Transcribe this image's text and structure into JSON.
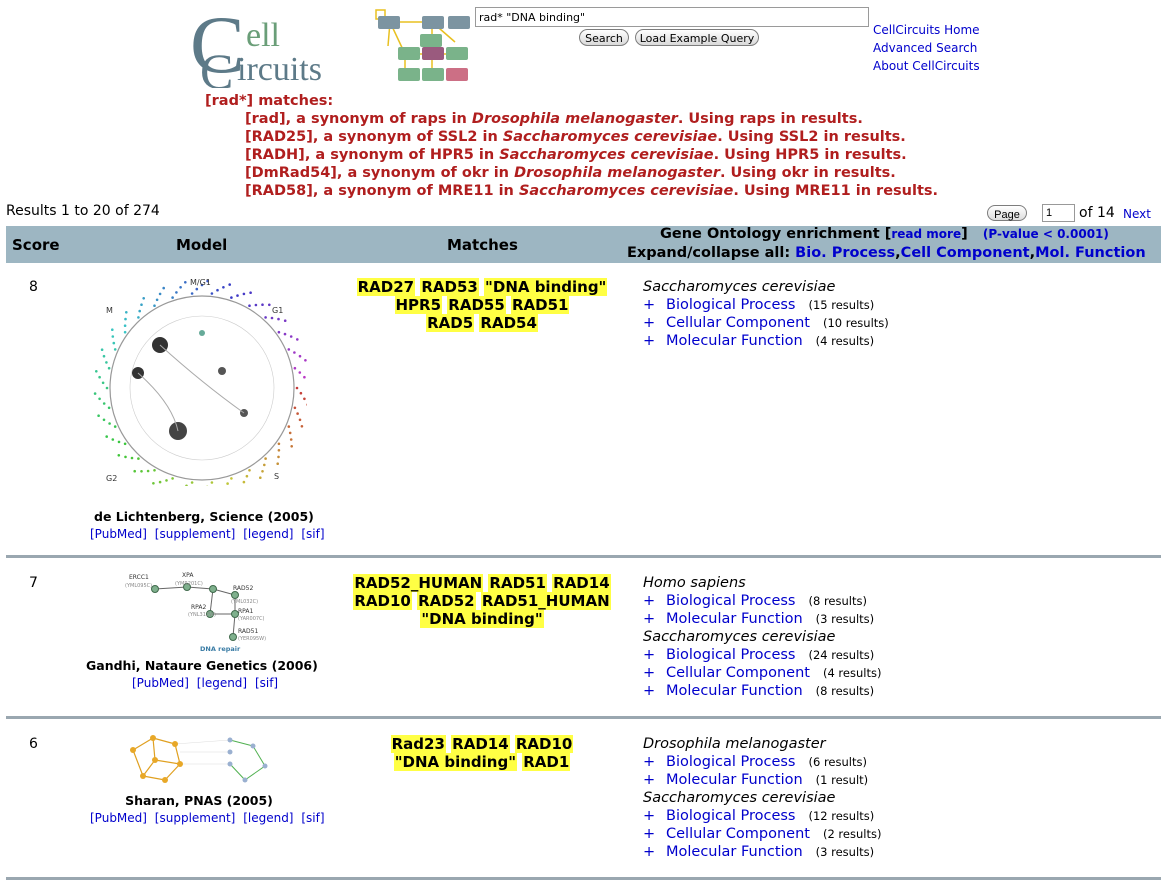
{
  "logo": {
    "word_top": "ell",
    "word_bottom": "ircuits",
    "letter_c": "C"
  },
  "search": {
    "value": "rad* \"DNA binding\"",
    "search_label": "Search",
    "example_label": "Load Example Query"
  },
  "nav": {
    "home": "CellCircuits Home",
    "advanced": "Advanced Search",
    "about": "About CellCircuits"
  },
  "synonyms": {
    "heading": "[rad*] matches:",
    "lines": [
      {
        "pre": "[rad], a synonym of raps in ",
        "species": "Drosophila melanogaster",
        "post": ". Using raps in results."
      },
      {
        "pre": "[RAD25], a synonym of SSL2 in ",
        "species": "Saccharomyces cerevisiae",
        "post": ". Using SSL2 in results."
      },
      {
        "pre": "[RADH], a synonym of HPR5 in ",
        "species": "Saccharomyces cerevisiae",
        "post": ". Using HPR5 in results."
      },
      {
        "pre": "[DmRad54], a synonym of okr in ",
        "species": "Drosophila melanogaster",
        "post": ". Using okr in results."
      },
      {
        "pre": "[RAD58], a synonym of MRE11 in ",
        "species": "Saccharomyces cerevisiae",
        "post": ". Using MRE11 in results."
      }
    ]
  },
  "results": {
    "summary": "Results 1 to 20 of 274",
    "page_button": "Page",
    "page_value": "1",
    "of_pages": "of 14",
    "next": "Next"
  },
  "table_header": {
    "score": "Score",
    "model": "Model",
    "matches": "Matches",
    "go_title": "Gene Ontology enrichment [",
    "read_more": "read more",
    "go_close": "]",
    "pvalue": "(P-value < 0.0001)",
    "expand": "Expand/collapse all: ",
    "bio": "Bio. Process",
    "cell": "Cell Component",
    "mol": "Mol. Function",
    "comma": ","
  },
  "rows": [
    {
      "score": "8",
      "citation": "de Lichtenberg, Science (2005)",
      "links": [
        "[PubMed]",
        "[supplement]",
        "[legend]",
        "[sif]"
      ],
      "figure_labels": {
        "top": "M/G1",
        "left": "M",
        "right": "G1",
        "bl": "G2",
        "br": "S"
      },
      "terms": [
        [
          "RAD27",
          "RAD53",
          "\"DNA binding\""
        ],
        [
          "HPR5",
          "RAD55",
          "RAD51"
        ],
        [
          "RAD5",
          "RAD54"
        ]
      ],
      "go": [
        {
          "species": "Saccharomyces cerevisiae",
          "items": [
            {
              "cat": "Biological Process",
              "count": "(15 results)"
            },
            {
              "cat": "Cellular Component",
              "count": "(10 results)"
            },
            {
              "cat": "Molecular Function",
              "count": "(4 results)"
            }
          ]
        }
      ]
    },
    {
      "score": "7",
      "citation": "Gandhi, Nataure Genetics (2006)",
      "links": [
        "[PubMed]",
        "[legend]",
        "[sif]"
      ],
      "figure_labels": {
        "n1": "ERCC1",
        "n1s": "(YML095C)",
        "n2": "XPA",
        "n2s": "(YMR201C)",
        "n3": "RAD52",
        "n3s": "(YML032C)",
        "n4": "RPA2",
        "n4s": "(YNL312W)",
        "n5": "RPA1",
        "n5s": "(YAR007C)",
        "n6": "RAD51",
        "n6s": "(YER095W)",
        "caption": "DNA repair"
      },
      "terms": [
        [
          "RAD52_HUMAN",
          "RAD51",
          "RAD14"
        ],
        [
          "RAD10",
          "RAD52",
          "RAD51_HUMAN"
        ],
        [
          "\"DNA binding\""
        ]
      ],
      "go": [
        {
          "species": "Homo sapiens",
          "items": [
            {
              "cat": "Biological Process",
              "count": "(8 results)"
            },
            {
              "cat": "Molecular Function",
              "count": "(3 results)"
            }
          ]
        },
        {
          "species": "Saccharomyces cerevisiae",
          "items": [
            {
              "cat": "Biological Process",
              "count": "(24 results)"
            },
            {
              "cat": "Cellular Component",
              "count": "(4 results)"
            },
            {
              "cat": "Molecular Function",
              "count": "(8 results)"
            }
          ]
        }
      ]
    },
    {
      "score": "6",
      "citation": "Sharan, PNAS (2005)",
      "links": [
        "[PubMed]",
        "[supplement]",
        "[legend]",
        "[sif]"
      ],
      "terms": [
        [
          "Rad23",
          "RAD14",
          "RAD10"
        ],
        [
          "\"DNA binding\"",
          "RAD1"
        ]
      ],
      "go": [
        {
          "species": "Drosophila melanogaster",
          "items": [
            {
              "cat": "Biological Process",
              "count": "(6 results)"
            },
            {
              "cat": "Molecular Function",
              "count": "(1 result)"
            }
          ]
        },
        {
          "species": "Saccharomyces cerevisiae",
          "items": [
            {
              "cat": "Biological Process",
              "count": "(12 results)"
            },
            {
              "cat": "Cellular Component",
              "count": "(2 results)"
            },
            {
              "cat": "Molecular Function",
              "count": "(3 results)"
            }
          ]
        }
      ]
    }
  ],
  "colors": {
    "accent_red": "#b01e1e",
    "link_blue": "#0000cc",
    "header_bar": "#9db6c2",
    "highlight": "#ffff44",
    "logo_slate": "#5d7a88",
    "logo_green": "#6a9e78"
  }
}
